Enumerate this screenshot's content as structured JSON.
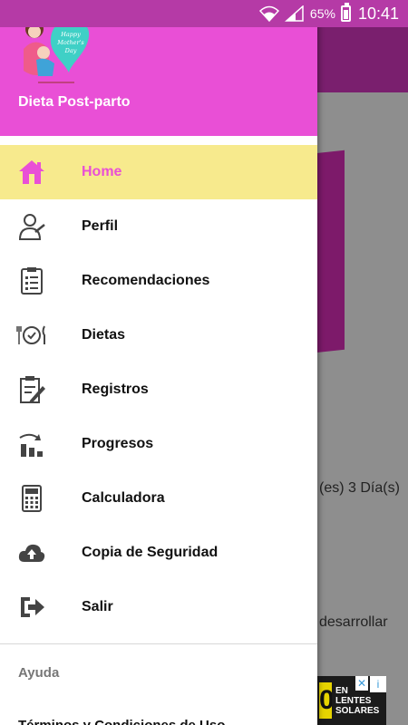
{
  "status_bar": {
    "battery_percent": "65%",
    "time": "10:41"
  },
  "drawer": {
    "app_title": "Dieta Post-parto",
    "logo_text": "Happy Mother's Day",
    "accent_color": "#e94fd6",
    "active_bg_color": "#f7ea8d",
    "items": [
      {
        "label": "Home",
        "icon": "home-icon",
        "active": true
      },
      {
        "label": "Perfil",
        "icon": "profile-icon",
        "active": false
      },
      {
        "label": "Recomendaciones",
        "icon": "clipboard-list-icon",
        "active": false
      },
      {
        "label": "Dietas",
        "icon": "plate-cutlery-icon",
        "active": false
      },
      {
        "label": "Registros",
        "icon": "clipboard-edit-icon",
        "active": false
      },
      {
        "label": "Progresos",
        "icon": "progress-chart-icon",
        "active": false
      },
      {
        "label": "Calculadora",
        "icon": "calculator-icon",
        "active": false
      },
      {
        "label": "Copia de Seguridad",
        "icon": "cloud-upload-icon",
        "active": false
      },
      {
        "label": "Salir",
        "icon": "exit-icon",
        "active": false
      }
    ],
    "section_header": "Ayuda",
    "terms_label": "Términos y Condiciones de Uso"
  },
  "background": {
    "text_line1": "(es) 3 Día(s)",
    "text_line2": "desarrollar",
    "ad": {
      "number": "0",
      "text_line1": "EN LENTES",
      "text_line2": "SOLARES"
    }
  }
}
